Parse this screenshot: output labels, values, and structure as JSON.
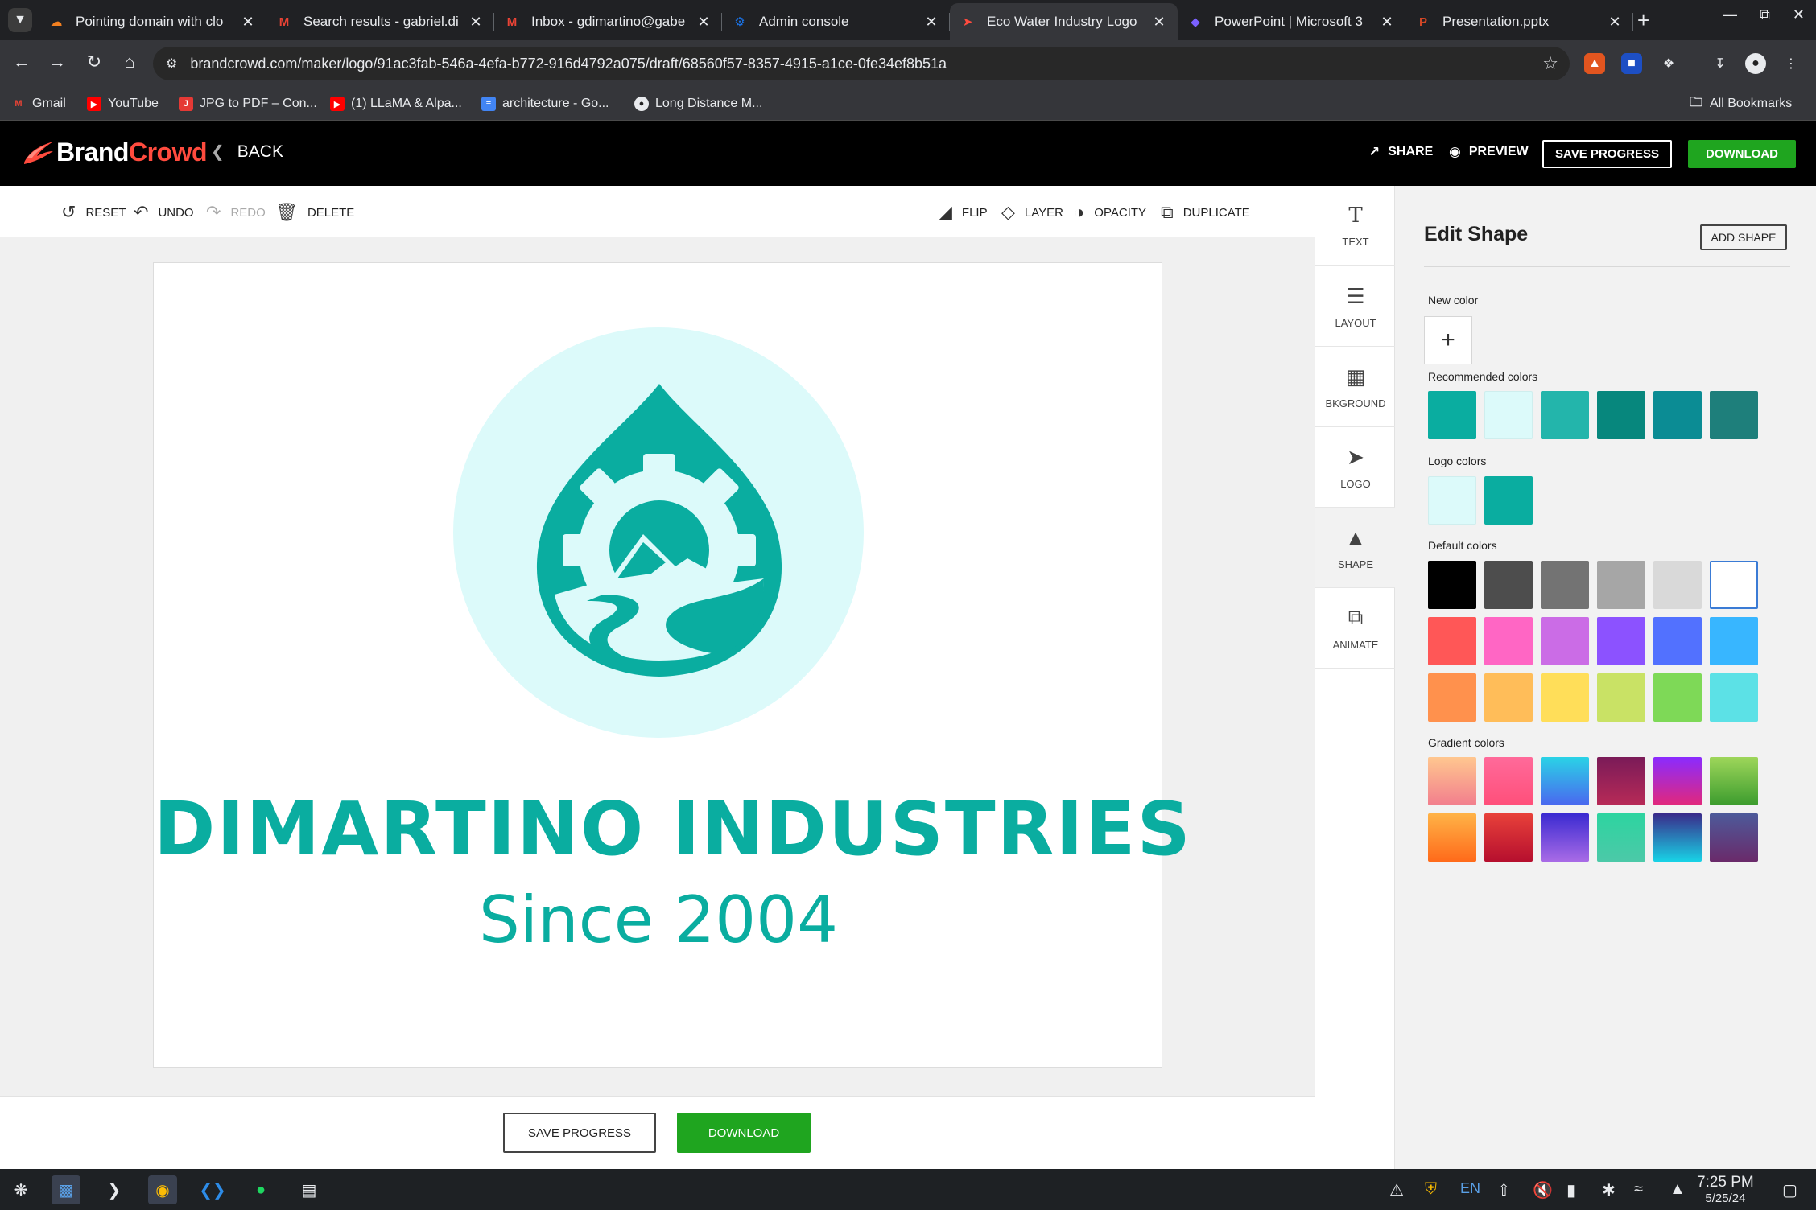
{
  "browser": {
    "tabs": [
      {
        "title": "Pointing domain with clo",
        "icon": "cloudflare-icon",
        "active": false
      },
      {
        "title": "Search results - gabriel.di",
        "icon": "gmail-icon",
        "active": false
      },
      {
        "title": "Inbox - gdimartino@gabe",
        "icon": "gmail-icon",
        "active": false
      },
      {
        "title": "Admin console",
        "icon": "gear-icon",
        "active": false
      },
      {
        "title": "Eco Water Industry Logo",
        "icon": "brandcrowd-icon",
        "active": true
      },
      {
        "title": "PowerPoint | Microsoft 3",
        "icon": "microsoft-icon",
        "active": false
      },
      {
        "title": "Presentation.pptx",
        "icon": "powerpoint-icon",
        "active": false
      }
    ],
    "url": "brandcrowd.com/maker/logo/91ac3fab-546a-4efa-b772-916d4792a075/draft/68560f57-8357-4915-a1ce-0fe34ef8b51a",
    "bookmarks": [
      {
        "label": "Gmail",
        "icon": "gmail-icon"
      },
      {
        "label": "YouTube",
        "icon": "youtube-icon"
      },
      {
        "label": "JPG to PDF – Con...",
        "icon": "jpg-pdf-icon"
      },
      {
        "label": "(1) LLaMA & Alpa...",
        "icon": "youtube-icon"
      },
      {
        "label": "architecture - Go...",
        "icon": "docs-icon"
      },
      {
        "label": "Long Distance M...",
        "icon": "site-icon"
      }
    ],
    "all_bookmarks": "All Bookmarks"
  },
  "header": {
    "brand_a": "Brand",
    "brand_b": "Crowd",
    "back": "BACK",
    "share": "SHARE",
    "preview": "PREVIEW",
    "save_progress": "SAVE PROGRESS",
    "download": "DOWNLOAD"
  },
  "toolbar": {
    "reset": "RESET",
    "undo": "UNDO",
    "redo": "REDO",
    "delete": "DELETE",
    "flip": "FLIP",
    "layer": "LAYER",
    "opacity": "OPACITY",
    "duplicate": "DUPLICATE"
  },
  "logo": {
    "title": "DIMARTINO INDUSTRIES",
    "subtitle": "Since 2004",
    "primary_color": "#0aada0",
    "circle_color": "#dcfafa"
  },
  "bottom": {
    "save_progress": "SAVE PROGRESS",
    "download": "DOWNLOAD"
  },
  "tools": [
    {
      "label": "TEXT",
      "icon": "text-icon"
    },
    {
      "label": "LAYOUT",
      "icon": "layout-icon"
    },
    {
      "label": "BKGROUND",
      "icon": "background-icon"
    },
    {
      "label": "LOGO",
      "icon": "logo-icon"
    },
    {
      "label": "SHAPE",
      "icon": "shape-icon",
      "active": true
    },
    {
      "label": "ANIMATE",
      "icon": "animate-icon"
    }
  ],
  "panel": {
    "title": "Edit Shape",
    "add_shape": "ADD SHAPE",
    "new_color_label": "New color",
    "recommended_label": "Recommended colors",
    "logo_colors_label": "Logo colors",
    "default_label": "Default colors",
    "gradient_label": "Gradient colors",
    "recommended": [
      "#0aada0",
      "#dcfafa",
      "#23b5ab",
      "#07877d",
      "#0b8c94",
      "#1e7f7b"
    ],
    "logo_colors": [
      "#dcfafa",
      "#0aada0"
    ],
    "default": [
      [
        "#000000",
        "#4d4d4d",
        "#737373",
        "#a6a6a6",
        "#d9d9d9",
        "#ffffff"
      ],
      [
        "#ff5757",
        "#ff66c4",
        "#cb6ce6",
        "#8c52ff",
        "#5271ff",
        "#38b6ff"
      ],
      [
        "#ff914d",
        "#ffbd59",
        "#ffde59",
        "#c9e265",
        "#7ed957",
        "#5ce1e6"
      ]
    ],
    "gradients": [
      [
        "linear-gradient(180deg,#ffc78f,#f27e8d)",
        "linear-gradient(180deg,#ff6a9a,#ff4f7a)",
        "linear-gradient(180deg,#2ad3e6,#4a67ef)",
        "linear-gradient(180deg,#7a1b58,#b82a57)",
        "linear-gradient(180deg,#8a2bff,#e2287b)",
        "linear-gradient(180deg,#9ed65a,#3c9c2e)"
      ],
      [
        "linear-gradient(180deg,#ffb347,#ff6a1a)",
        "linear-gradient(180deg,#e8413a,#b60f2e)",
        "linear-gradient(180deg,#3a2ad1,#a96be6)",
        "linear-gradient(180deg,#2dd4a0,#4cc9a8)",
        "linear-gradient(180deg,#3a2a8a,#18d3e6)",
        "linear-gradient(180deg,#4d5a9a,#6a2a6a)"
      ]
    ]
  },
  "taskbar": {
    "lang": "EN",
    "time": "7:25 PM",
    "date": "5/25/24"
  }
}
